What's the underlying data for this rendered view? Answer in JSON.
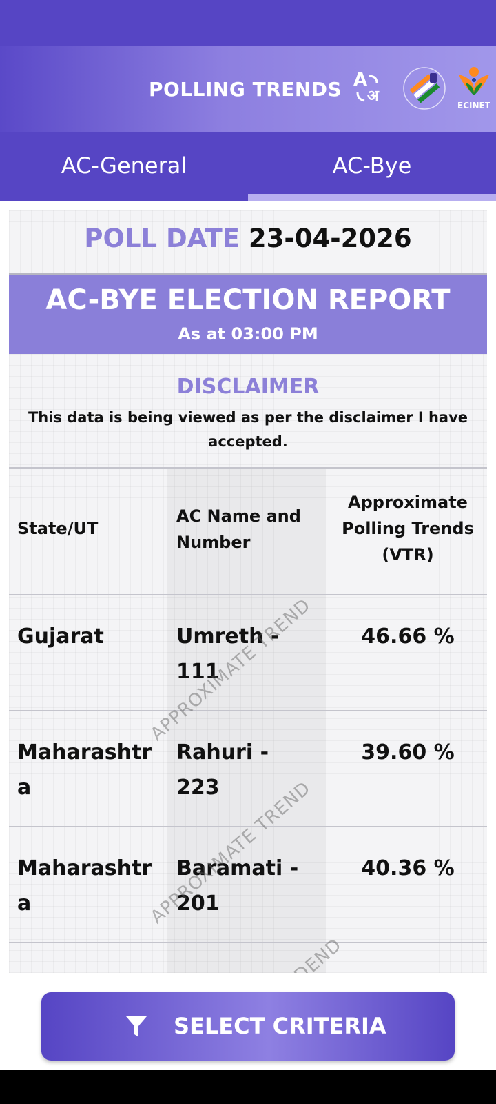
{
  "header": {
    "title": "POLLING TRENDS",
    "ecinet_label": "ECINET"
  },
  "tabs": [
    {
      "label": "AC-General",
      "selected": false
    },
    {
      "label": "AC-Bye",
      "selected": true
    }
  ],
  "poll_date": {
    "label": "POLL DATE",
    "value": "23-04-2026"
  },
  "report": {
    "title": "AC-BYE ELECTION REPORT",
    "subtitle": "As at 03:00 PM"
  },
  "disclaimer": {
    "title": "DISCLAIMER",
    "text": "This data is being viewed as per the disclaimer I have accepted."
  },
  "table": {
    "headers": [
      "State/UT",
      "AC Name and Number",
      "Approximate Polling Trends (VTR)"
    ],
    "rows": [
      {
        "state": "Gujarat",
        "ac": "Umreth - 111",
        "vtr": "46.66 %"
      },
      {
        "state": "Maharashtra",
        "ac": "Rahuri - 223",
        "vtr": "39.60 %"
      },
      {
        "state": "Maharashtra",
        "ac": "Baramati - 201",
        "vtr": "40.36 %"
      }
    ]
  },
  "watermark": "APPROXIMATE TREND",
  "watermark_fragment": "END",
  "buttons": {
    "select_criteria": "SELECT CRITERIA"
  },
  "colors": {
    "primary": "#5645c4",
    "accent": "#8c80d8",
    "tab_indicator": "#b7aef0"
  }
}
